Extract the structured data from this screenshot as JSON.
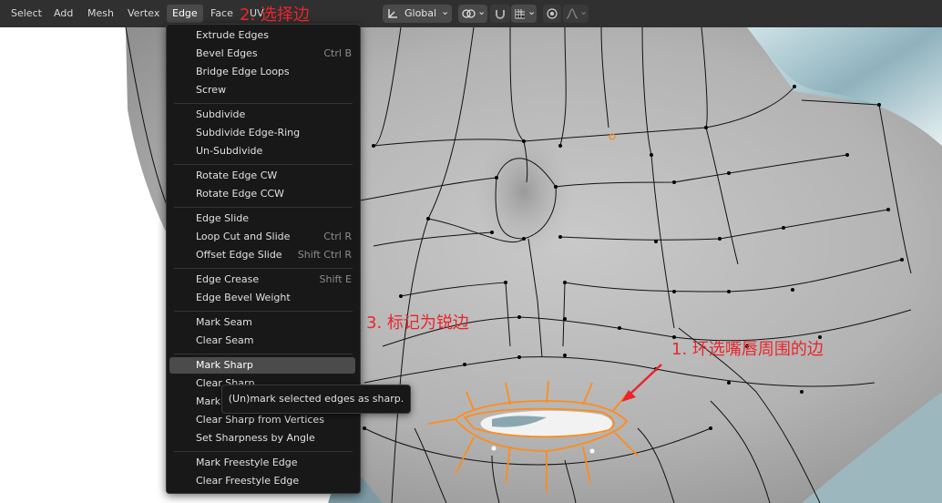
{
  "menubar": {
    "items": [
      "Select",
      "Add",
      "Mesh",
      "Vertex",
      "Edge",
      "Face",
      "UV"
    ],
    "active": "Edge"
  },
  "toolbar": {
    "orientation": "Global",
    "chevron": "⌄"
  },
  "edge_menu": {
    "groups": [
      [
        {
          "label": "Extrude Edges",
          "shortcut": ""
        },
        {
          "label": "Bevel Edges",
          "shortcut": "Ctrl B"
        },
        {
          "label": "Bridge Edge Loops",
          "shortcut": ""
        },
        {
          "label": "Screw",
          "shortcut": ""
        }
      ],
      [
        {
          "label": "Subdivide",
          "shortcut": ""
        },
        {
          "label": "Subdivide Edge-Ring",
          "shortcut": ""
        },
        {
          "label": "Un-Subdivide",
          "shortcut": ""
        }
      ],
      [
        {
          "label": "Rotate Edge CW",
          "shortcut": ""
        },
        {
          "label": "Rotate Edge CCW",
          "shortcut": ""
        }
      ],
      [
        {
          "label": "Edge Slide",
          "shortcut": ""
        },
        {
          "label": "Loop Cut and Slide",
          "shortcut": "Ctrl R"
        },
        {
          "label": "Offset Edge Slide",
          "shortcut": "Shift Ctrl R"
        }
      ],
      [
        {
          "label": "Edge Crease",
          "shortcut": "Shift E"
        },
        {
          "label": "Edge Bevel Weight",
          "shortcut": ""
        }
      ],
      [
        {
          "label": "Mark Seam",
          "shortcut": ""
        },
        {
          "label": "Clear Seam",
          "shortcut": ""
        }
      ],
      [
        {
          "label": "Mark Sharp",
          "shortcut": "",
          "highlighted": true
        },
        {
          "label": "Clear Sharp",
          "shortcut": ""
        },
        {
          "label": "Mark",
          "shortcut": ""
        },
        {
          "label": "Clear Sharp from Vertices",
          "shortcut": ""
        },
        {
          "label": "Set Sharpness by Angle",
          "shortcut": ""
        }
      ],
      [
        {
          "label": "Mark Freestyle Edge",
          "shortcut": ""
        },
        {
          "label": "Clear Freestyle Edge",
          "shortcut": ""
        }
      ]
    ]
  },
  "tooltip": {
    "text": "(Un)mark selected edges as sharp."
  },
  "annotations": {
    "step1": "1. 环选嘴唇周围的边",
    "step2": "2. 选择边",
    "step3": "3. 标记为锐边"
  },
  "colors": {
    "annotation": "#e8262c",
    "selection": "#ff8c1a",
    "menu_bg": "#181818",
    "header_bg": "#303030"
  }
}
